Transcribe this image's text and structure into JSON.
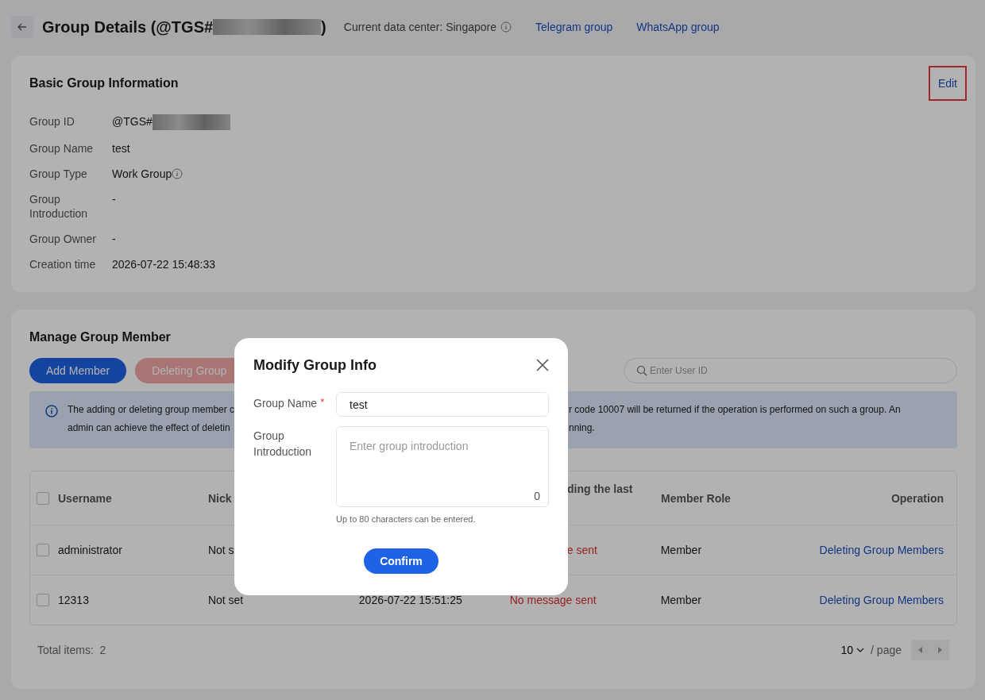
{
  "header": {
    "title": "Group Details (@TGS#",
    "title_end": ")",
    "data_center": "Current data center: Singapore",
    "links": [
      "Telegram group",
      "WhatsApp group"
    ]
  },
  "basic_info": {
    "title": "Basic Group Information",
    "edit": {
      "label": "Edit",
      "highlighted": true
    },
    "fields": [
      {
        "label": "Group ID",
        "value": "@TGS#",
        "kind": "redacted"
      },
      {
        "label": "Group Name",
        "value": "test",
        "kind": "text"
      },
      {
        "label": "Group Type",
        "value": "Work Group",
        "kind": "info"
      },
      {
        "label": "Group Introduction",
        "value": "-",
        "kind": "text"
      },
      {
        "label": "Group Owner",
        "value": "-",
        "kind": "text"
      },
      {
        "label": "Creation time",
        "value": "2026-07-22 15:48:33",
        "kind": "text"
      }
    ]
  },
  "members": {
    "title": "Manage Group Member",
    "buttons": [
      {
        "label": "Add Member",
        "disabled": false
      },
      {
        "label": "Deleting Group",
        "disabled": true
      }
    ],
    "search": {
      "placeholder": "Enter User ID"
    },
    "notice": [
      {
        "left": "The adding or deleting group member c",
        "right": "r code 10007 will be returned if the operation is performed on such a group. An"
      },
      {
        "left": "admin can achieve the effect of deletin",
        "right": "nning."
      }
    ],
    "table": {
      "header_checked": false,
      "columns": [
        {
          "label": "Username",
          "kind": "text"
        },
        {
          "label": "Nick",
          "kind": "text"
        },
        {
          "kind": "text"
        },
        {
          "label": "ding the last",
          "kind": "status"
        },
        {
          "label": "Member Role",
          "kind": "text"
        },
        {
          "label": "Operation",
          "kind": "link"
        }
      ],
      "rows": [
        {
          "checked": false,
          "cells": [
            "administrator",
            "Not s",
            null,
            "e sent",
            "Member",
            "Deleting Group Members"
          ]
        },
        {
          "checked": false,
          "cells": [
            "12313",
            "Not set",
            "2026-07-22 15:51:25",
            "No message sent",
            "Member",
            "Deleting Group Members"
          ]
        }
      ]
    },
    "total": "Total items:  2",
    "page_size": "10",
    "per_page": "/ page"
  },
  "dialog": {
    "title": "Modify Group Info",
    "name_field": {
      "label": "Group Name",
      "required_mark": "*",
      "value": "test"
    },
    "intro_field": {
      "label": "Group Introduction",
      "placeholder": "Enter group introduction",
      "count": "0"
    },
    "hint": "Up to 80 characters can be entered.",
    "confirm": "Confirm"
  }
}
